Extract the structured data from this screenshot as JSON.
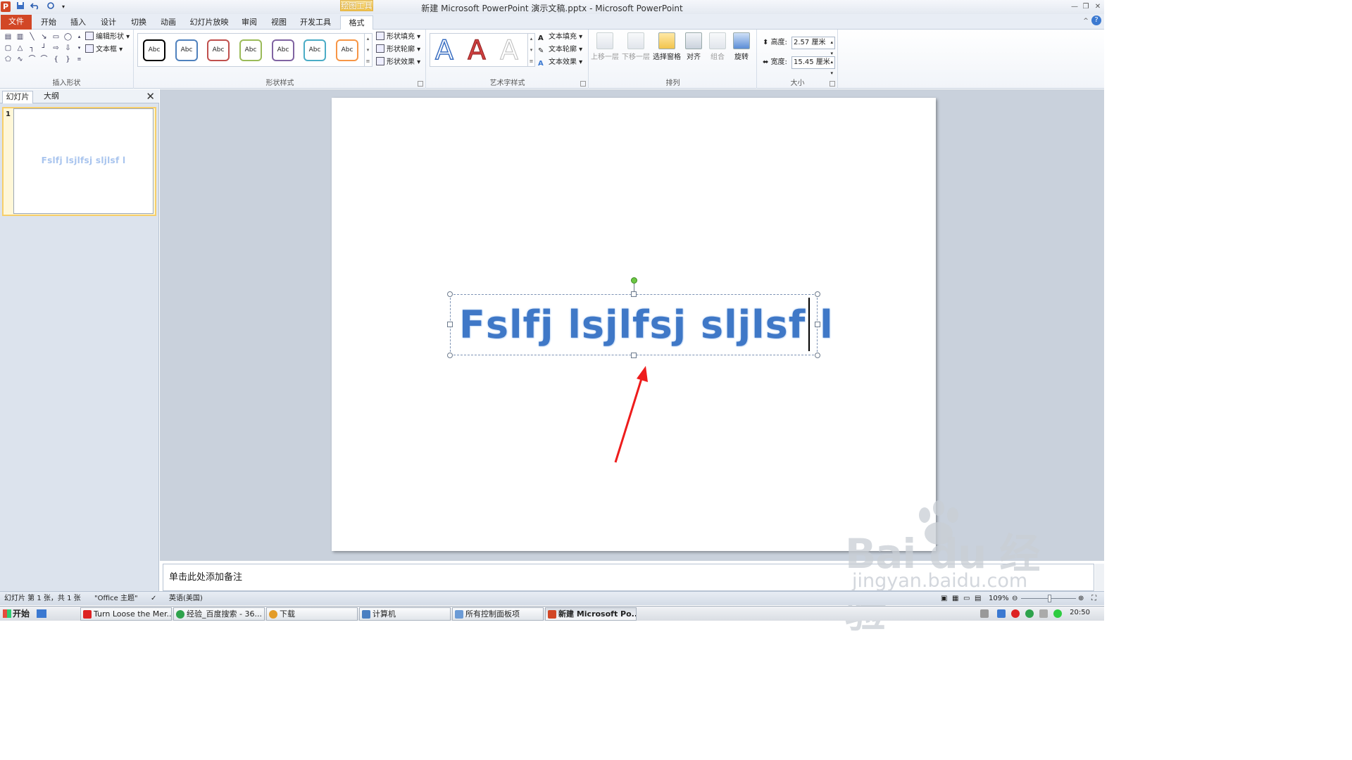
{
  "titlebar": {
    "title": "新建 Microsoft PowerPoint 演示文稿.pptx  -  Microsoft PowerPoint",
    "app_logo": "P",
    "context_tab": "绘图工具"
  },
  "tabs": [
    "文件",
    "开始",
    "插入",
    "设计",
    "切换",
    "动画",
    "幻灯片放映",
    "审阅",
    "视图",
    "开发工具",
    "格式"
  ],
  "ribbon": {
    "insert_shapes": {
      "label": "插入形状",
      "edit_shape": "编辑形状",
      "text_box": "文本框"
    },
    "shape_styles": {
      "label": "形状样式",
      "styles": [
        "Abc",
        "Abc",
        "Abc",
        "Abc",
        "Abc",
        "Abc",
        "Abc"
      ],
      "style_colors": [
        "#000000",
        "#4f81bd",
        "#c0504d",
        "#9bbb59",
        "#8064a2",
        "#4bacc6",
        "#f79646"
      ],
      "fill": "形状填充",
      "outline": "形状轮廓",
      "effects": "形状效果"
    },
    "wordart": {
      "label": "艺术字样式",
      "letters": [
        "A",
        "A",
        "A"
      ],
      "fill": "文本填充",
      "outline": "文本轮廓",
      "effects": "文本效果"
    },
    "arrange": {
      "label": "排列",
      "bring_forward": "上移一层",
      "send_backward": "下移一层",
      "selection_pane": "选择窗格",
      "align": "对齐",
      "group": "组合",
      "rotate": "旋转"
    },
    "size": {
      "label": "大小",
      "height_label": "高度:",
      "height_value": "2.57 厘米",
      "width_label": "宽度:",
      "width_value": "15.45 厘米"
    }
  },
  "left_panel": {
    "tab_slides": "幻灯片",
    "tab_outline": "大纲",
    "close": "✕",
    "slide_number": "1",
    "thumb_text": "Fslfj lsjlfsj sljlsf l"
  },
  "slide": {
    "text": "Fslfj lsjlfsj sljlsf l"
  },
  "notes": {
    "placeholder": "单击此处添加备注"
  },
  "watermark": {
    "main": "Bai  du 经验",
    "sub": "jingyan.baidu.com"
  },
  "statusbar": {
    "slide_info": "幻灯片 第 1 张，共 1 张",
    "theme": "\"Office 主题\"",
    "language": "英语(美国)",
    "zoom": "109%"
  },
  "taskbar": {
    "start": "开始",
    "tasks": [
      "Turn Loose the Mer...",
      "经验_百度搜索 - 36...",
      "下载",
      "计算机",
      "所有控制面板项",
      "新建 Microsoft Po..."
    ],
    "clock": "20:50"
  }
}
